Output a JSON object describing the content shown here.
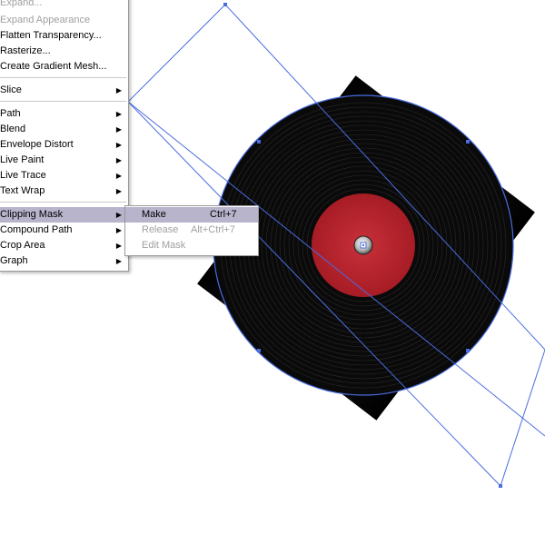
{
  "object_menu": {
    "items": [
      {
        "label": "Expand...",
        "disabled": false,
        "submenu": false
      },
      {
        "label": "Expand Appearance",
        "disabled": true,
        "submenu": false
      },
      {
        "label": "Flatten Transparency...",
        "disabled": false,
        "submenu": false
      },
      {
        "label": "Rasterize...",
        "disabled": false,
        "submenu": false
      },
      {
        "label": "Create Gradient Mesh...",
        "disabled": false,
        "submenu": false
      },
      {
        "label": "Slice",
        "disabled": false,
        "submenu": true
      },
      {
        "label": "Path",
        "disabled": false,
        "submenu": true
      },
      {
        "label": "Blend",
        "disabled": false,
        "submenu": true
      },
      {
        "label": "Envelope Distort",
        "disabled": false,
        "submenu": true
      },
      {
        "label": "Live Paint",
        "disabled": false,
        "submenu": true
      },
      {
        "label": "Live Trace",
        "disabled": false,
        "submenu": true
      },
      {
        "label": "Text Wrap",
        "disabled": false,
        "submenu": true
      },
      {
        "label": "Clipping Mask",
        "disabled": false,
        "submenu": true,
        "highlighted": true
      },
      {
        "label": "Compound Path",
        "disabled": false,
        "submenu": true
      },
      {
        "label": "Crop Area",
        "disabled": false,
        "submenu": true
      },
      {
        "label": "Graph",
        "disabled": false,
        "submenu": true
      }
    ]
  },
  "clipping_mask_submenu": {
    "items": [
      {
        "label": "Make",
        "shortcut": "Ctrl+7",
        "disabled": false,
        "highlighted": true
      },
      {
        "label": "Release",
        "shortcut": "Alt+Ctrl+7",
        "disabled": true
      },
      {
        "label": "Edit Mask",
        "shortcut": "",
        "disabled": true
      }
    ]
  },
  "colors": {
    "menu_highlight": "#b7b4cc",
    "selection_blue": "#4a6de0",
    "record_label_red": "#b8232b",
    "record_black": "#0a0a0a"
  },
  "icons": {
    "submenu_arrow": "submenu-arrow-icon",
    "center_point": "center-point-icon"
  }
}
